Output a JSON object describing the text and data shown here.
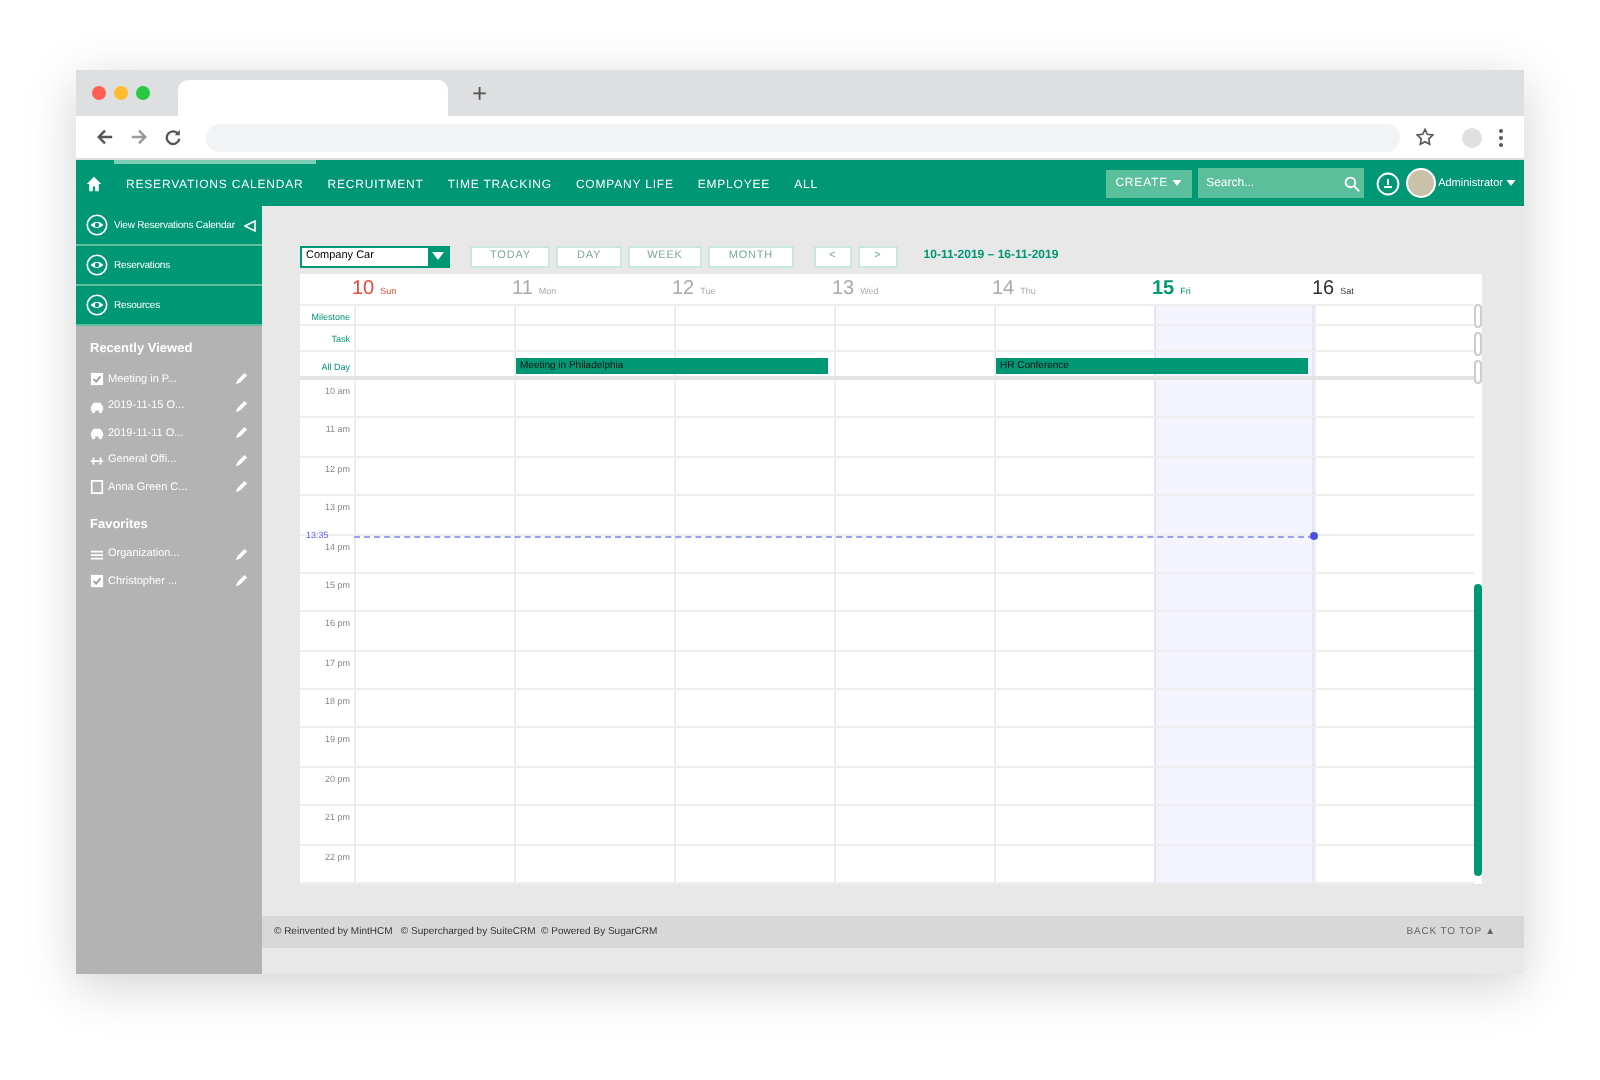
{
  "browser": {
    "new_tab": "+"
  },
  "nav": {
    "items": [
      {
        "label": "RESERVATIONS CALENDAR",
        "selected": true
      },
      {
        "label": "RECRUITMENT",
        "selected": false
      },
      {
        "label": "TIME TRACKING",
        "selected": false
      },
      {
        "label": "COMPANY LIFE",
        "selected": false
      },
      {
        "label": "EMPLOYEE",
        "selected": false
      },
      {
        "label": "ALL",
        "selected": false
      }
    ],
    "create": "CREATE",
    "search_placeholder": "Search...",
    "user": "Administrator"
  },
  "sidebar": {
    "actions": [
      "View Reservations Calendar",
      "Reservations",
      "Resources"
    ],
    "recent_title": "Recently Viewed",
    "recent": [
      {
        "label": "Meeting in P...",
        "kind": "meeting"
      },
      {
        "label": "2019-11-15 O...",
        "kind": "car"
      },
      {
        "label": "2019-11-11 O...",
        "kind": "car"
      },
      {
        "label": "General Offi...",
        "kind": "room"
      },
      {
        "label": "Anna Green C...",
        "kind": "doc"
      }
    ],
    "favorites_title": "Favorites",
    "favorites": [
      {
        "label": "Organization...",
        "kind": "list"
      },
      {
        "label": "Christopher ...",
        "kind": "meeting"
      }
    ]
  },
  "toolbar": {
    "resource": "Company Car",
    "buttons": [
      "TODAY",
      "DAY",
      "WEEK",
      "MONTH"
    ],
    "prev": "<",
    "next": ">",
    "range": "10-11-2019 – 16-11-2019"
  },
  "calendar": {
    "days": [
      {
        "number": "10",
        "weekday": "Sun",
        "color": "#e8473c",
        "selected": false
      },
      {
        "number": "11",
        "weekday": "Mon",
        "color": "#aaaaaa",
        "selected": false,
        "all_day": {
          "kind": "start",
          "title": "Meeting in Philadelphia"
        }
      },
      {
        "number": "12",
        "weekday": "Tue",
        "color": "#aaaaaa",
        "selected": false,
        "all_day": {
          "kind": "end"
        }
      },
      {
        "number": "13",
        "weekday": "Wed",
        "color": "#aaaaaa",
        "selected": false
      },
      {
        "number": "14",
        "weekday": "Thu",
        "color": "#aaaaaa",
        "selected": false,
        "all_day": {
          "kind": "start",
          "title": "HR Conference"
        }
      },
      {
        "number": "15",
        "weekday": "Fri",
        "color": "#009774",
        "selected": true,
        "all_day": {
          "kind": "end"
        }
      },
      {
        "number": "16",
        "weekday": "Sat",
        "color": "#333333",
        "selected": false
      }
    ],
    "row_labels": [
      "Milestone",
      "Task",
      "All Day"
    ],
    "hours": [
      {
        "label": "10 am"
      },
      {
        "label": "11 am"
      },
      {
        "label": "12 pm"
      },
      {
        "label": "13 pm",
        "now": "13:35"
      },
      {
        "label": "14 pm"
      },
      {
        "label": "15 pm"
      },
      {
        "label": "16 pm"
      },
      {
        "label": "17 pm"
      },
      {
        "label": "18 pm"
      },
      {
        "label": "19 pm"
      },
      {
        "label": "20 pm"
      },
      {
        "label": "21 pm"
      },
      {
        "label": "22 pm"
      }
    ]
  },
  "footer": {
    "credits": "© Reinvented by MintHCM   © Supercharged by SuiteCRM  © Powered By SugarCRM",
    "back_to_top": "BACK TO TOP ▲"
  }
}
